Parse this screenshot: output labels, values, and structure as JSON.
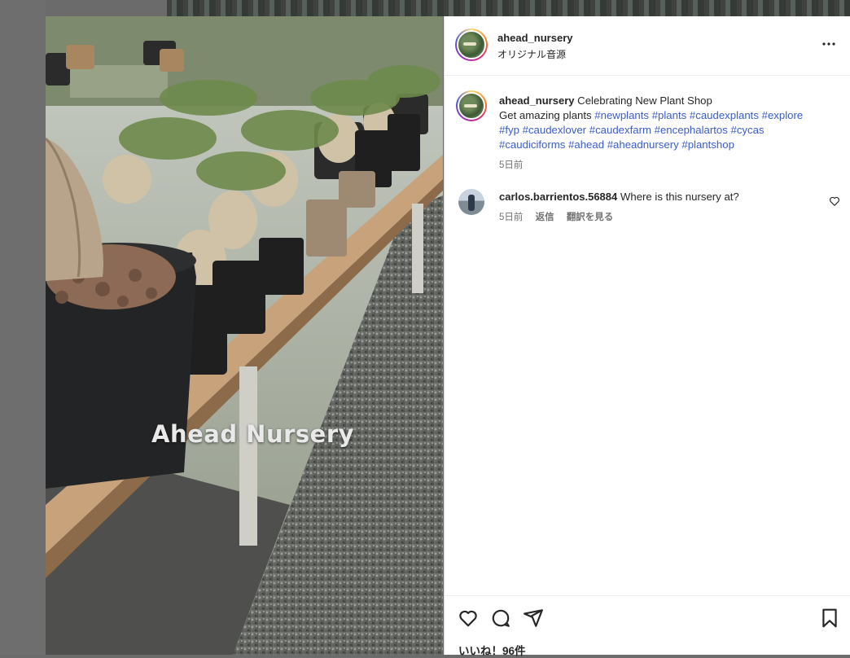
{
  "post": {
    "username": "ahead_nursery",
    "audio": "オリジナル音源",
    "video_overlay_text": "Ahead Nursery"
  },
  "caption": {
    "username": "ahead_nursery",
    "text_1": "Celebrating New Plant Shop",
    "text_2": "Get amazing plants",
    "hashtags": [
      "#newplants",
      "#plants",
      "#caudexplants",
      "#explore",
      "#fyp",
      "#caudexlover",
      "#caudexfarm",
      "#encephalartos",
      "#cycas",
      "#caudiciforms",
      "#ahead",
      "#aheadnursery",
      "#plantshop"
    ],
    "time": "5日前"
  },
  "comments": [
    {
      "username": "carlos.barrientos.56884",
      "text": "Where is this nursery at?",
      "time": "5日前",
      "reply_label": "返信",
      "translate_label": "翻訳を見る"
    }
  ],
  "footer": {
    "likes": "いいね！96件"
  },
  "icons": {
    "more": "more-options-icon",
    "like": "heart-icon",
    "comment": "comment-icon",
    "share": "share-icon",
    "save": "bookmark-icon"
  },
  "colors": {
    "hashtag": "#3b5cc9",
    "text": "#262626",
    "muted": "#737373"
  }
}
